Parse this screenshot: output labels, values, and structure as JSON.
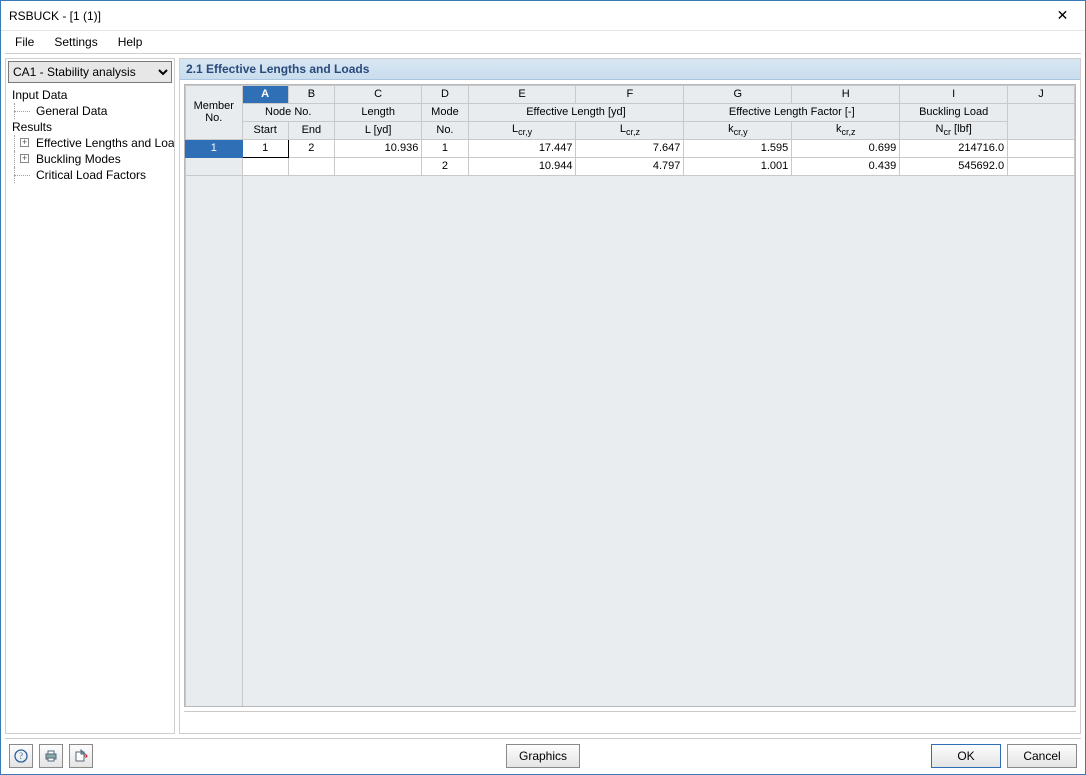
{
  "title": "RSBUCK - [1 (1)]",
  "close_glyph": "✕",
  "menu": {
    "file": "File",
    "settings": "Settings",
    "help": "Help"
  },
  "case_selector": "CA1 - Stability analysis",
  "tree": {
    "input_data": "Input Data",
    "general_data": "General Data",
    "results": "Results",
    "eff_lengths": "Effective Lengths and Loads",
    "buckling_modes": "Buckling Modes",
    "critical_load_factors": "Critical Load Factors"
  },
  "panel_heading": "2.1 Effective Lengths and Loads",
  "columns": {
    "letters": [
      "A",
      "B",
      "C",
      "D",
      "E",
      "F",
      "G",
      "H",
      "I",
      "J"
    ],
    "member_no": "Member\nNo.",
    "node_no": "Node No.",
    "start": "Start",
    "end": "End",
    "length": "Length",
    "length_sub": "L [yd]",
    "mode": "Mode",
    "mode_sub": "No.",
    "eff_len": "Effective Length [yd]",
    "lcry": "Lcr,y",
    "lcrz": "Lcr,z",
    "eff_fac": "Effective Length Factor [-]",
    "kcry": "kcr,y",
    "kcrz": "kcr,z",
    "buck_load": "Buckling Load",
    "ncr": "Ncr [lbf]"
  },
  "rows": [
    {
      "member": "1",
      "start": "1",
      "end": "2",
      "L": "10.936",
      "mode": "1",
      "Lcry": "17.447",
      "Lcrz": "7.647",
      "kcry": "1.595",
      "kcrz": "0.699",
      "Ncr": "214716.0"
    },
    {
      "member": "",
      "start": "",
      "end": "",
      "L": "",
      "mode": "2",
      "Lcry": "10.944",
      "Lcrz": "4.797",
      "kcry": "1.001",
      "kcrz": "0.439",
      "Ncr": "545692.0"
    }
  ],
  "icon_names": {
    "help": "?",
    "print": "print",
    "export": "export"
  },
  "buttons": {
    "graphics": "Graphics",
    "ok": "OK",
    "cancel": "Cancel"
  }
}
